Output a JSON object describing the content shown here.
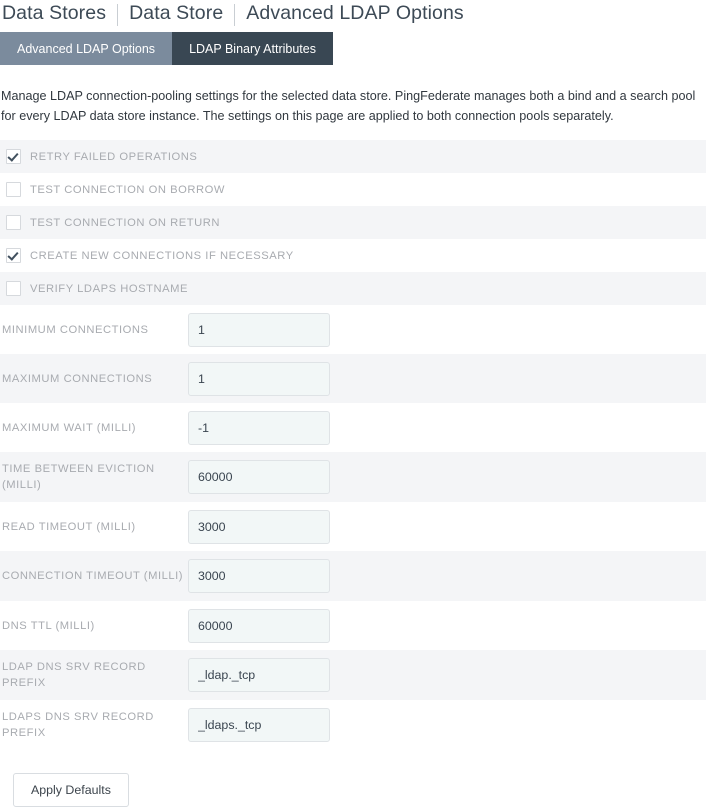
{
  "breadcrumb": {
    "items": [
      "Data Stores",
      "Data Store",
      "Advanced LDAP Options"
    ]
  },
  "tabs": [
    {
      "label": "Advanced LDAP Options",
      "active": true
    },
    {
      "label": "LDAP Binary Attributes",
      "active": false
    }
  ],
  "intro": {
    "text": "Manage LDAP connection-pooling settings for the selected data store. PingFederate manages both a bind and a search pool for every LDAP data store instance. The settings on this page are applied to both connection pools separately."
  },
  "checkboxes": [
    {
      "label": "RETRY FAILED OPERATIONS",
      "checked": true
    },
    {
      "label": "TEST CONNECTION ON BORROW",
      "checked": false
    },
    {
      "label": "TEST CONNECTION ON RETURN",
      "checked": false
    },
    {
      "label": "CREATE NEW CONNECTIONS IF NECESSARY",
      "checked": true
    },
    {
      "label": "VERIFY LDAPS HOSTNAME",
      "checked": false
    }
  ],
  "fields": [
    {
      "label": "MINIMUM CONNECTIONS",
      "value": "1",
      "twoline": false
    },
    {
      "label": "MAXIMUM CONNECTIONS",
      "value": "1",
      "twoline": false
    },
    {
      "label": "MAXIMUM WAIT (MILLI)",
      "value": "-1",
      "twoline": false
    },
    {
      "label": "TIME BETWEEN EVICTION (MILLI)",
      "value": "60000",
      "twoline": true
    },
    {
      "label": "READ TIMEOUT (MILLI)",
      "value": "3000",
      "twoline": false
    },
    {
      "label": "CONNECTION TIMEOUT (MILLI)",
      "value": "3000",
      "twoline": true
    },
    {
      "label": "DNS TTL (MILLI)",
      "value": "60000",
      "twoline": false
    },
    {
      "label": "LDAP DNS SRV RECORD PREFIX",
      "value": "_ldap._tcp",
      "twoline": true
    },
    {
      "label": "LDAPS DNS SRV RECORD PREFIX",
      "value": "_ldaps._tcp",
      "twoline": true
    }
  ],
  "buttons": {
    "apply_defaults": "Apply Defaults"
  },
  "colors": {
    "tab_active_bg": "#7b8b9d",
    "tab_inactive_bg": "#394753",
    "row_shaded_bg": "#f4f5f7",
    "row_plain_bg": "#ffffff",
    "label_text": "#a8abb0",
    "input_bg": "#f2f7f7",
    "input_border": "#dfe3e6",
    "breadcrumb_text": "#3d4a56",
    "check_mark": "#41505e"
  }
}
